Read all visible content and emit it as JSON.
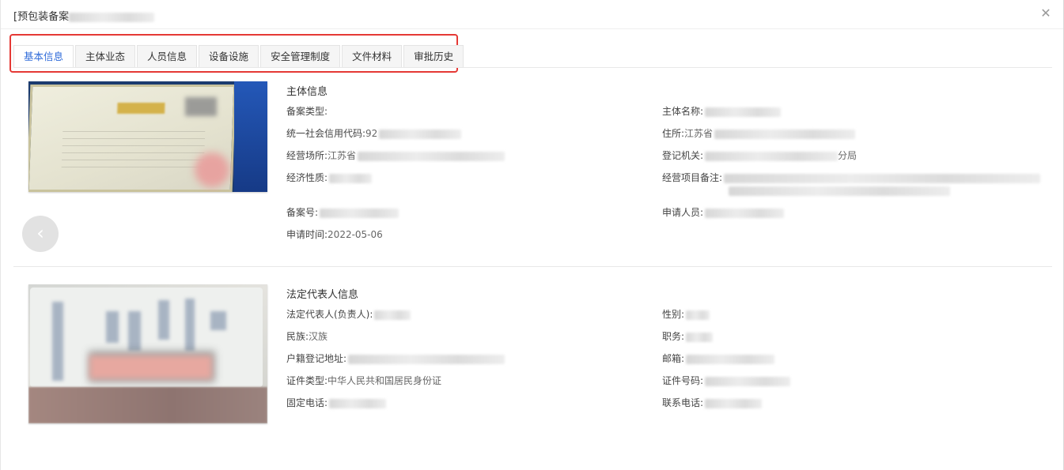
{
  "dialog": {
    "title": "[预包装备案"
  },
  "tabs": [
    {
      "label": "基本信息",
      "active": true
    },
    {
      "label": "主体业态",
      "active": false
    },
    {
      "label": "人员信息",
      "active": false
    },
    {
      "label": "设备设施",
      "active": false
    },
    {
      "label": "安全管理制度",
      "active": false
    },
    {
      "label": "文件材料",
      "active": false
    },
    {
      "label": "审批历史",
      "active": false
    }
  ],
  "colors": {
    "accent": "#2f6bd9",
    "highlight": "#e53935",
    "close_icon": "#999999"
  },
  "icons": {
    "close": "close-icon",
    "carousel_prev": "chevron-left-icon"
  },
  "entity": {
    "title": "主体信息",
    "record_type_label": "备案类型:",
    "record_type_value": "",
    "entity_name_label": "主体名称:",
    "credit_code_label": "统一社会信用代码:",
    "credit_code_value": "92",
    "address_label": "住所:",
    "address_value": "江苏省",
    "business_place_label": "经营场所:",
    "business_place_value": "江苏省",
    "reg_authority_label": "登记机关:",
    "reg_authority_value": "分局",
    "econ_nature_label": "经济性质:",
    "project_note_label": "经营项目备注:",
    "project_note_value": "",
    "record_no_label": "备案号:",
    "applicant_label": "申请人员:",
    "apply_time_label": "申请时间:",
    "apply_time_value": "2022-05-06"
  },
  "legal_rep": {
    "title": "法定代表人信息",
    "name_label": "法定代表人(负责人):",
    "gender_label": "性别:",
    "ethnicity_label": "民族:",
    "ethnicity_value": "汉族",
    "position_label": "职务:",
    "household_addr_label": "户籍登记地址:",
    "email_label": "邮箱:",
    "id_type_label": "证件类型:",
    "id_type_value": "中华人民共和国居民身份证",
    "id_no_label": "证件号码:",
    "landline_label": "固定电话:",
    "phone_label": "联系电话:"
  }
}
